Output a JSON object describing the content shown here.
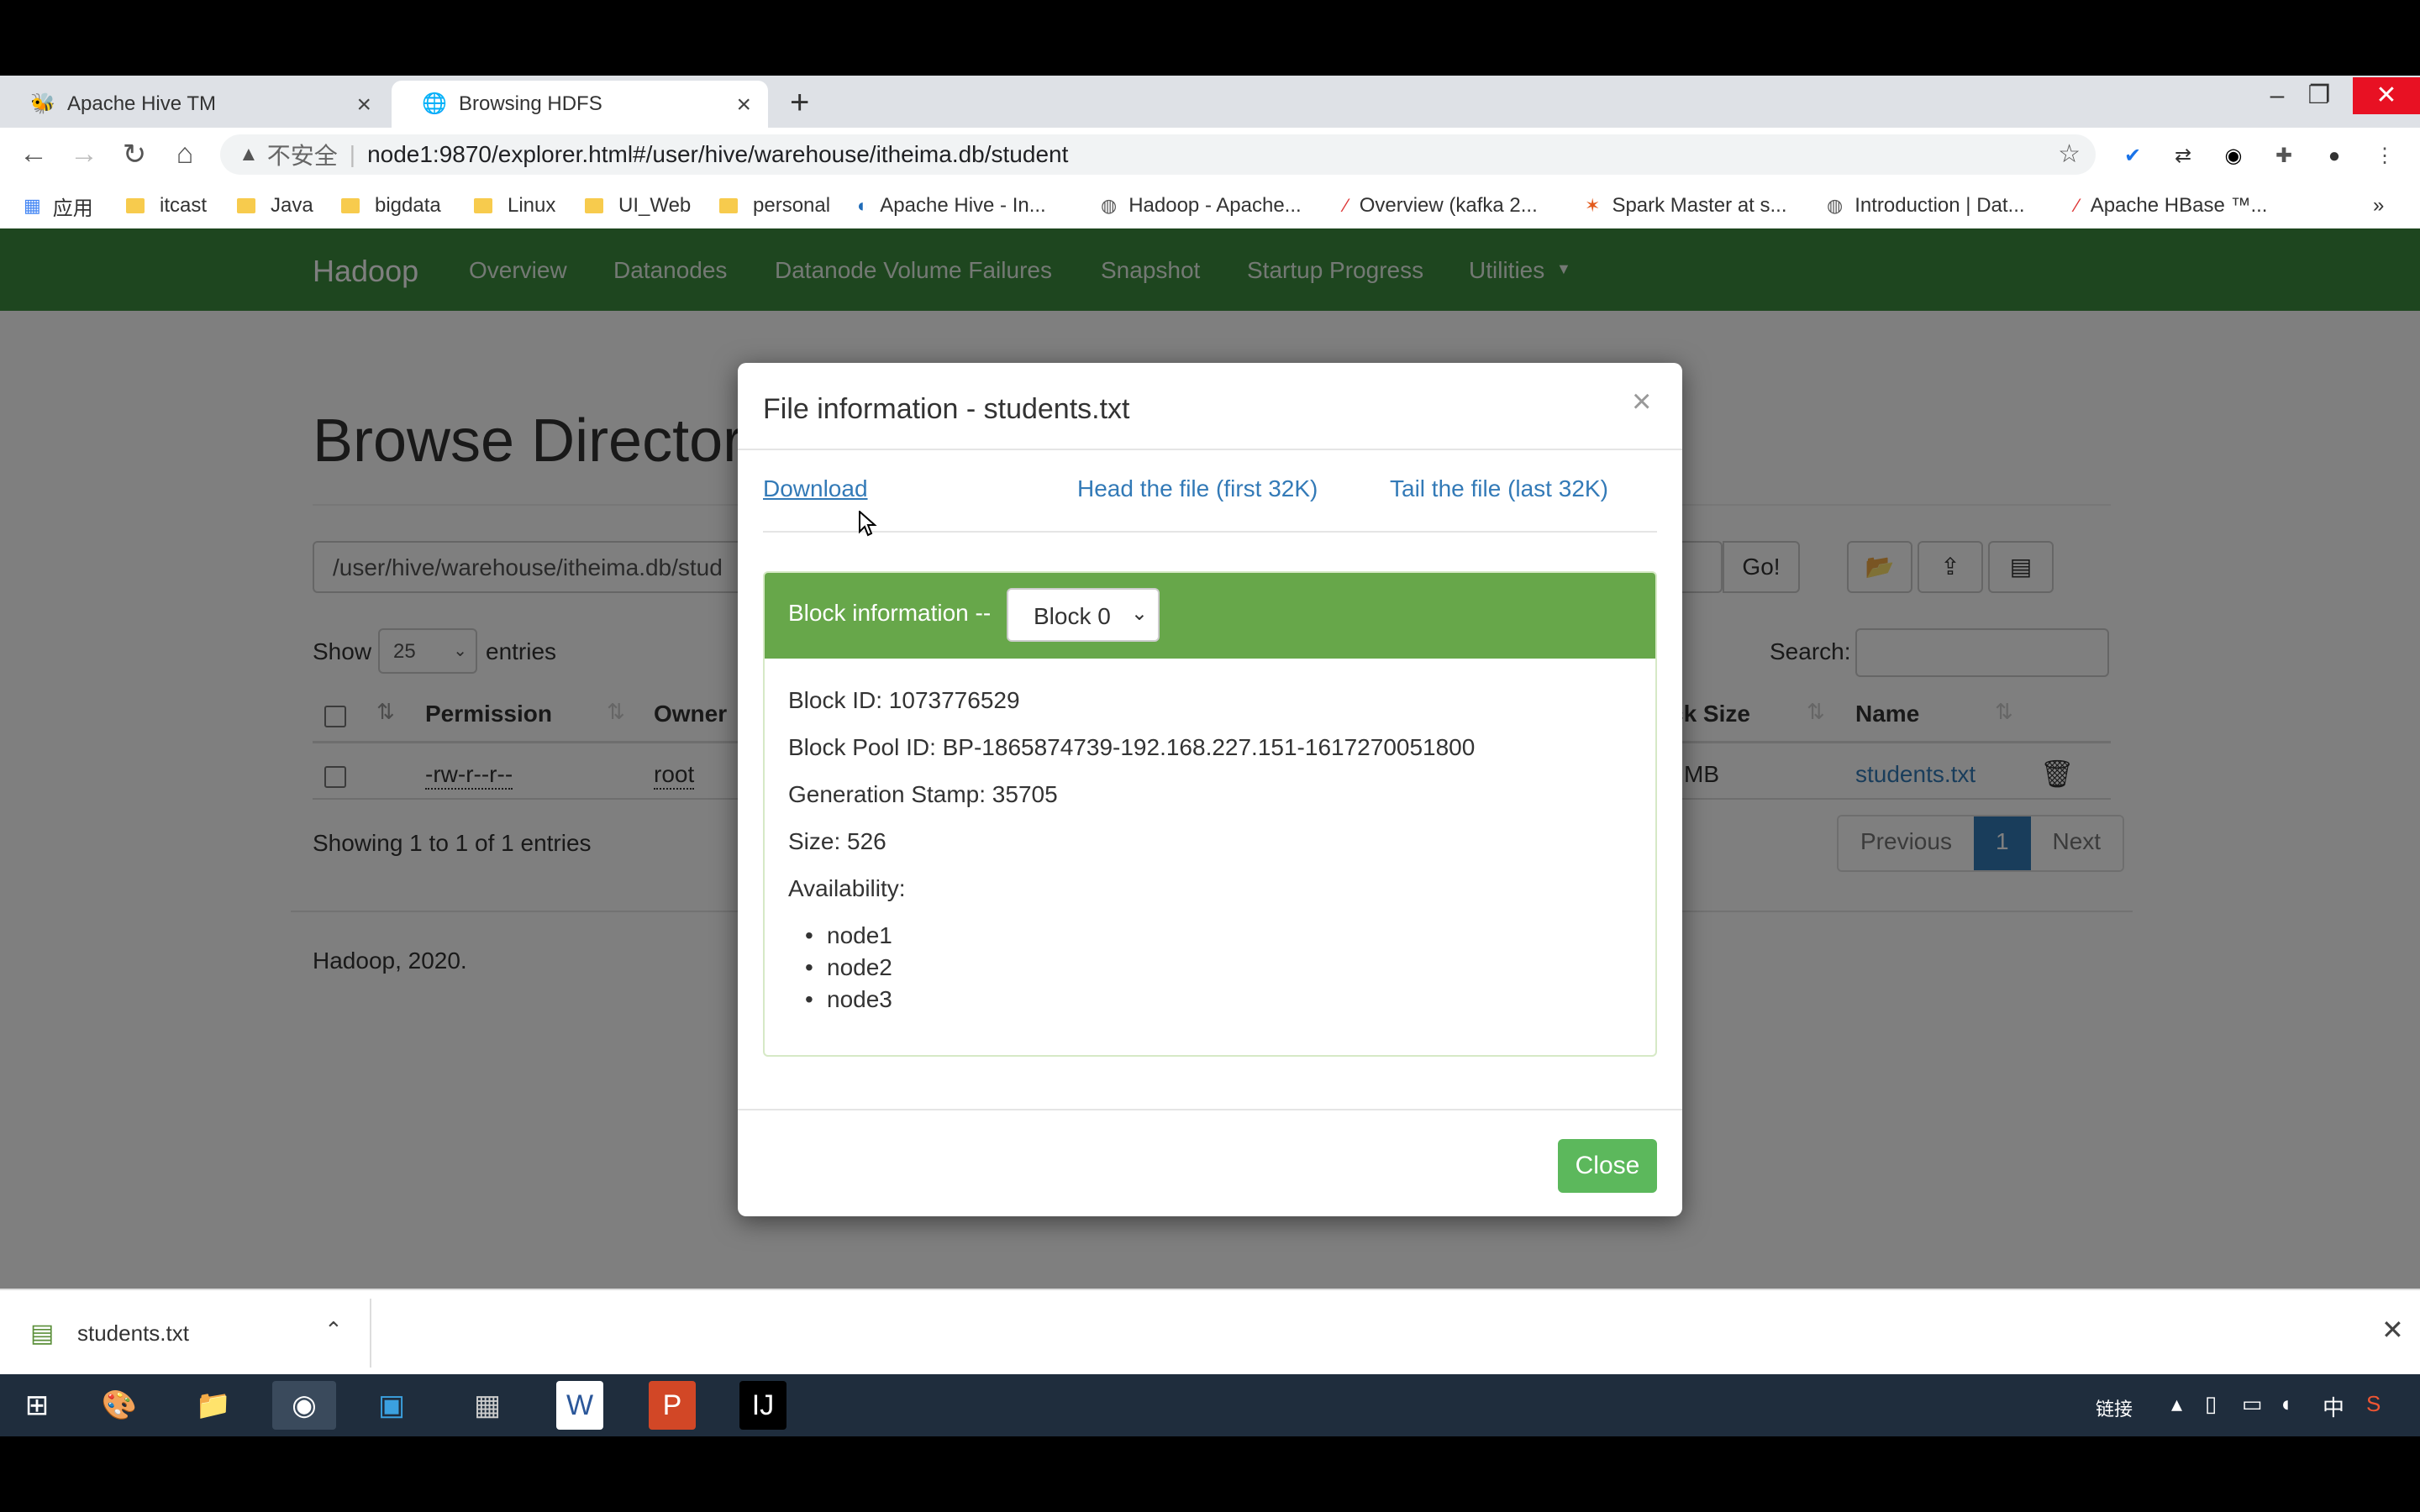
{
  "tabs": [
    {
      "label": "Apache Hive TM",
      "icon": "hive-bee-icon"
    },
    {
      "label": "Browsing HDFS",
      "icon": "globe-icon"
    }
  ],
  "address": {
    "insecure_label": "不安全",
    "url": "node1:9870/explorer.html#/user/hive/warehouse/itheima.db/student"
  },
  "bookmarks": [
    "应用",
    "itcast",
    "Java",
    "bigdata",
    "Linux",
    "UI_Web",
    "personal",
    "Apache Hive - In...",
    "Hadoop - Apache...",
    "Overview (kafka 2...",
    "Spark Master at s...",
    "Introduction | Dat...",
    "Apache HBase ™..."
  ],
  "hadoop_nav": {
    "brand": "Hadoop",
    "items": [
      "Overview",
      "Datanodes",
      "Datanode Volume Failures",
      "Snapshot",
      "Startup Progress",
      "Utilities"
    ]
  },
  "browse": {
    "title": "Browse Director",
    "path": "/user/hive/warehouse/itheima.db/stud",
    "go_label": "Go!",
    "show_label": "Show",
    "show_value": "25",
    "entries_label": "entries",
    "search_label": "Search:",
    "columns": {
      "permission": "Permission",
      "owner": "Owner",
      "block_size": "ck Size",
      "name": "Name"
    },
    "row": {
      "permission": "-rw-r--r--",
      "owner": "root",
      "block_size": "MB",
      "name": "students.txt"
    },
    "showing": "Showing 1 to 1 of 1 entries",
    "pager": {
      "previous": "Previous",
      "page": "1",
      "next": "Next"
    },
    "footer": "Hadoop, 2020."
  },
  "modal": {
    "title": "File information - students.txt",
    "download": "Download",
    "head": "Head the file (first 32K)",
    "tail": "Tail the file (last 32K)",
    "block_label": "Block information --",
    "block_select": "Block 0",
    "block_id": "Block ID: 1073776529",
    "block_pool_id": "Block Pool ID: BP-1865874739-192.168.227.151-1617270051800",
    "generation_stamp": "Generation Stamp: 35705",
    "size": "Size: 526",
    "availability": "Availability:",
    "nodes": [
      "node1",
      "node2",
      "node3"
    ],
    "close": "Close"
  },
  "downloads": {
    "file": "students.txt"
  },
  "taskbar": {
    "tray_label": "链接",
    "ime": "中"
  },
  "colors": {
    "hadoop_green": "#3c8c3f",
    "panel_green": "#67a74a",
    "close_green": "#5cb85c",
    "link_blue": "#337ab7"
  }
}
